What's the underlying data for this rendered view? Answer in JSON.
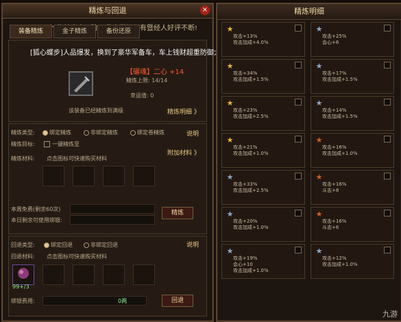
{
  "left_window": {
    "title": "精炼与回退",
    "close_label": "×",
    "tabs": [
      "装备精炼",
      "金子精炼",
      "备份还原"
    ],
    "marquee": "一个[抱枕金喜一阶]! 欣喜国祝贺有暨经人好评不断!"
  },
  "main": {
    "message": "[狐心蝶步]人品爆发，换到了豪华军备车，车上钱财超重防御大幅降低，是劫匪的首选!",
    "item_name": "【碾魂】二心 +14",
    "refine_limit": "精炼上限: 14/14",
    "luck": "幸运值: 0",
    "fully_refined": "该装备已经精炼到满级",
    "detail_link": "精炼明细 》"
  },
  "refine": {
    "type_label": "精炼类型:",
    "type_opts": [
      "绑定精炼",
      "非绑定精炼",
      "绑定卷精炼"
    ],
    "desc_link": "说明",
    "target_label": "精炼目标:",
    "one_key": "一键精炼至",
    "material_label": "精炼材料:",
    "material_hint": "点击图标可快速购买材料",
    "add_material": "附加材料 》",
    "free_today": "本周免费(剩余60次)",
    "remaining_bind": "本日剩余可使用绑银:",
    "refine_btn": "精炼"
  },
  "rollback": {
    "type_label": "回退类型:",
    "type_opts": [
      "绑定回退",
      "非绑定回退"
    ],
    "desc_link": "说明",
    "material_label": "回退材料:",
    "material_hint": "点击图标可快速购买材料",
    "item_count": "99+/3",
    "cost_label": "绑银费用:",
    "cost_value": "0两",
    "rollback_btn": "回退"
  },
  "right_window": {
    "title": "精炼明细",
    "cells": [
      {
        "star": "gold",
        "lines": [
          "攻击+13%",
          "攻击加成+4.0%"
        ]
      },
      {
        "star": "blue",
        "lines": [
          "攻击+25%",
          "会心+6"
        ]
      },
      {
        "star": "gold",
        "lines": [
          "攻击+34%",
          "攻击加成+1.5%"
        ]
      },
      {
        "star": "blue",
        "lines": [
          "攻击+17%",
          "攻击加成+1.5%"
        ]
      },
      {
        "star": "gold",
        "lines": [
          "攻击+23%",
          "攻击加成+2.5%"
        ]
      },
      {
        "star": "blue",
        "lines": [
          "攻击+14%",
          "攻击加成+1.5%"
        ]
      },
      {
        "star": "gold",
        "lines": [
          "攻击+21%",
          "攻击加成+1.0%"
        ]
      },
      {
        "star": "red",
        "lines": [
          "攻击+16%",
          "攻击加成+1.0%"
        ]
      },
      {
        "star": "blue",
        "lines": [
          "攻击+33%",
          "攻击加成+2.5%"
        ]
      },
      {
        "star": "red",
        "lines": [
          "攻击+16%",
          "斗志+8"
        ]
      },
      {
        "star": "blue",
        "lines": [
          "攻击+20%",
          "攻击加成+1.0%"
        ]
      },
      {
        "star": "red",
        "lines": [
          "攻击+16%",
          "斗志+6"
        ]
      },
      {
        "star": "blue",
        "lines": [
          "攻击+19%",
          "会心+10",
          "攻击加成+1.0%"
        ]
      },
      {
        "star": "blue",
        "lines": [
          "攻击+12%",
          "攻击加成+1.0%"
        ]
      }
    ]
  },
  "watermark": "九游",
  "colors": {
    "gold": "#e6b63a",
    "blue": "#8fa8c8",
    "red": "#c9612a"
  }
}
